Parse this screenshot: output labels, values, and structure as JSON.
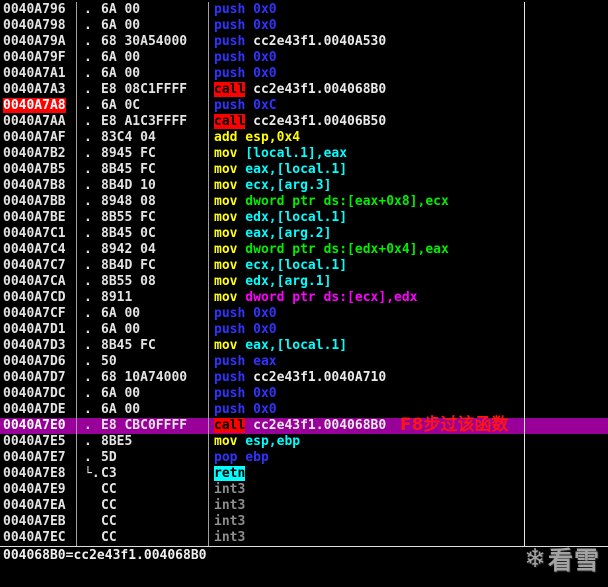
{
  "app": "disassembler-debugger-view",
  "palette": {
    "background": "#000000",
    "address_text": "#e4e4e4",
    "push_pop": "#3232ff",
    "mov_add": "#ffff00",
    "stack_operand": "#00ffff",
    "mem_operand_green": "#00ee00",
    "mem_operand_magenta": "#ff00ff",
    "plain_operand": "#eaeaea",
    "int3": "#8c8c8c",
    "call_highlight_bg": "#ff0000",
    "retn_highlight_bg": "#00ffff",
    "selected_row_bg": "#990099",
    "breakpoint_bg": "#ff0000",
    "annotation": "#ff1414"
  },
  "disassembly": {
    "rows": [
      {
        "addr": "0040A796",
        "prefix": ".",
        "bytes": "6A 00",
        "disasm": [
          {
            "text": "push",
            "color": "blue"
          },
          {
            "text": " 0x0",
            "color": "blue"
          }
        ]
      },
      {
        "addr": "0040A798",
        "prefix": ".",
        "bytes": "6A 00",
        "disasm": [
          {
            "text": "push",
            "color": "blue"
          },
          {
            "text": " 0x0",
            "color": "blue"
          }
        ]
      },
      {
        "addr": "0040A79A",
        "prefix": ".",
        "bytes": "68 30A54000",
        "disasm": [
          {
            "text": "push",
            "color": "blue"
          },
          {
            "text": " cc2e43f1.0040A530",
            "color": "white"
          }
        ]
      },
      {
        "addr": "0040A79F",
        "prefix": ".",
        "bytes": "6A 00",
        "disasm": [
          {
            "text": "push",
            "color": "blue"
          },
          {
            "text": " 0x0",
            "color": "blue"
          }
        ]
      },
      {
        "addr": "0040A7A1",
        "prefix": ".",
        "bytes": "6A 00",
        "disasm": [
          {
            "text": "push",
            "color": "blue"
          },
          {
            "text": " 0x0",
            "color": "blue"
          }
        ]
      },
      {
        "addr": "0040A7A3",
        "prefix": ".",
        "bytes": "E8 08C1FFFF",
        "disasm": [
          {
            "text": "call",
            "color": "call"
          },
          {
            "text": " cc2e43f1.004068B0",
            "color": "white"
          }
        ]
      },
      {
        "addr": "0040A7A8",
        "breakpoint": true,
        "prefix": ".",
        "bytes": "6A 0C",
        "disasm": [
          {
            "text": "push",
            "color": "blue"
          },
          {
            "text": " 0xC",
            "color": "blue"
          }
        ]
      },
      {
        "addr": "0040A7AA",
        "prefix": ".",
        "bytes": "E8 A1C3FFFF",
        "disasm": [
          {
            "text": "call",
            "color": "call"
          },
          {
            "text": " cc2e43f1.00406B50",
            "color": "white"
          }
        ]
      },
      {
        "addr": "0040A7AF",
        "prefix": ".",
        "bytes": "83C4 04",
        "disasm": [
          {
            "text": "add",
            "color": "yellow"
          },
          {
            "text": " esp,0x4",
            "color": "yellow"
          }
        ]
      },
      {
        "addr": "0040A7B2",
        "prefix": ".",
        "bytes": "8945 FC",
        "disasm": [
          {
            "text": "mov",
            "color": "yellow"
          },
          {
            "text": " [local.1],eax",
            "color": "cyan"
          }
        ]
      },
      {
        "addr": "0040A7B5",
        "prefix": ".",
        "bytes": "8B45 FC",
        "disasm": [
          {
            "text": "mov",
            "color": "yellow"
          },
          {
            "text": " eax,[local.1]",
            "color": "cyan"
          }
        ]
      },
      {
        "addr": "0040A7B8",
        "prefix": ".",
        "bytes": "8B4D 10",
        "disasm": [
          {
            "text": "mov",
            "color": "yellow"
          },
          {
            "text": " ecx,[arg.3]",
            "color": "cyan"
          }
        ]
      },
      {
        "addr": "0040A7BB",
        "prefix": ".",
        "bytes": "8948 08",
        "disasm": [
          {
            "text": "mov",
            "color": "yellow"
          },
          {
            "text": " dword ptr ds:[eax+0x8],ecx",
            "color": "green"
          }
        ]
      },
      {
        "addr": "0040A7BE",
        "prefix": ".",
        "bytes": "8B55 FC",
        "disasm": [
          {
            "text": "mov",
            "color": "yellow"
          },
          {
            "text": " edx,[local.1]",
            "color": "cyan"
          }
        ]
      },
      {
        "addr": "0040A7C1",
        "prefix": ".",
        "bytes": "8B45 0C",
        "disasm": [
          {
            "text": "mov",
            "color": "yellow"
          },
          {
            "text": " eax,[arg.2]",
            "color": "cyan"
          }
        ]
      },
      {
        "addr": "0040A7C4",
        "prefix": ".",
        "bytes": "8942 04",
        "disasm": [
          {
            "text": "mov",
            "color": "yellow"
          },
          {
            "text": " dword ptr ds:[edx+0x4],eax",
            "color": "green"
          }
        ]
      },
      {
        "addr": "0040A7C7",
        "prefix": ".",
        "bytes": "8B4D FC",
        "disasm": [
          {
            "text": "mov",
            "color": "yellow"
          },
          {
            "text": " ecx,[local.1]",
            "color": "cyan"
          }
        ]
      },
      {
        "addr": "0040A7CA",
        "prefix": ".",
        "bytes": "8B55 08",
        "disasm": [
          {
            "text": "mov",
            "color": "yellow"
          },
          {
            "text": " edx,[arg.1]",
            "color": "cyan"
          }
        ]
      },
      {
        "addr": "0040A7CD",
        "prefix": ".",
        "bytes": "8911",
        "disasm": [
          {
            "text": "mov",
            "color": "yellow"
          },
          {
            "text": " dword ptr ds:[ecx],edx",
            "color": "magenta"
          }
        ]
      },
      {
        "addr": "0040A7CF",
        "prefix": ".",
        "bytes": "6A 00",
        "disasm": [
          {
            "text": "push",
            "color": "blue"
          },
          {
            "text": " 0x0",
            "color": "blue"
          }
        ]
      },
      {
        "addr": "0040A7D1",
        "prefix": ".",
        "bytes": "6A 00",
        "disasm": [
          {
            "text": "push",
            "color": "blue"
          },
          {
            "text": " 0x0",
            "color": "blue"
          }
        ]
      },
      {
        "addr": "0040A7D3",
        "prefix": ".",
        "bytes": "8B45 FC",
        "disasm": [
          {
            "text": "mov",
            "color": "yellow"
          },
          {
            "text": " eax,[local.1]",
            "color": "cyan"
          }
        ]
      },
      {
        "addr": "0040A7D6",
        "prefix": ".",
        "bytes": "50",
        "disasm": [
          {
            "text": "push",
            "color": "blue"
          },
          {
            "text": " eax",
            "color": "blue"
          }
        ]
      },
      {
        "addr": "0040A7D7",
        "prefix": ".",
        "bytes": "68 10A74000",
        "disasm": [
          {
            "text": "push",
            "color": "blue"
          },
          {
            "text": " cc2e43f1.0040A710",
            "color": "white"
          }
        ]
      },
      {
        "addr": "0040A7DC",
        "prefix": ".",
        "bytes": "6A 00",
        "disasm": [
          {
            "text": "push",
            "color": "blue"
          },
          {
            "text": " 0x0",
            "color": "blue"
          }
        ]
      },
      {
        "addr": "0040A7DE",
        "prefix": ".",
        "bytes": "6A 00",
        "disasm": [
          {
            "text": "push",
            "color": "blue"
          },
          {
            "text": " 0x0",
            "color": "blue"
          }
        ]
      },
      {
        "addr": "0040A7E0",
        "selected": true,
        "prefix": ".",
        "bytes": "E8 CBC0FFFF",
        "disasm": [
          {
            "text": "call",
            "color": "call"
          },
          {
            "text": " cc2e43f1.004068B0",
            "color": "white"
          }
        ],
        "annotation": "F8步过该函数"
      },
      {
        "addr": "0040A7E5",
        "prefix": ".",
        "bytes": "8BE5",
        "disasm": [
          {
            "text": "mov",
            "color": "yellow"
          },
          {
            "text": " esp,ebp",
            "color": "cyan"
          }
        ]
      },
      {
        "addr": "0040A7E7",
        "prefix": ".",
        "bytes": "5D",
        "disasm": [
          {
            "text": "pop",
            "color": "blue"
          },
          {
            "text": " ebp",
            "color": "blue"
          }
        ]
      },
      {
        "addr": "0040A7E8",
        "prefix": "└.",
        "bytes": "C3",
        "disasm": [
          {
            "text": "retn",
            "color": "retn"
          }
        ]
      },
      {
        "addr": "0040A7E9",
        "prefix": "",
        "bytes": "CC",
        "disasm": [
          {
            "text": "int3",
            "color": "gray"
          }
        ]
      },
      {
        "addr": "0040A7EA",
        "prefix": "",
        "bytes": "CC",
        "disasm": [
          {
            "text": "int3",
            "color": "gray"
          }
        ]
      },
      {
        "addr": "0040A7EB",
        "prefix": "",
        "bytes": "CC",
        "disasm": [
          {
            "text": "int3",
            "color": "gray"
          }
        ]
      },
      {
        "addr": "0040A7EC",
        "prefix": "",
        "bytes": "CC",
        "disasm": [
          {
            "text": "int3",
            "color": "gray"
          }
        ]
      }
    ]
  },
  "status_bar": {
    "text": "004068B0=cc2e43f1.004068B0"
  },
  "watermark": {
    "icon_glyph": "❄",
    "text": "看雪"
  }
}
